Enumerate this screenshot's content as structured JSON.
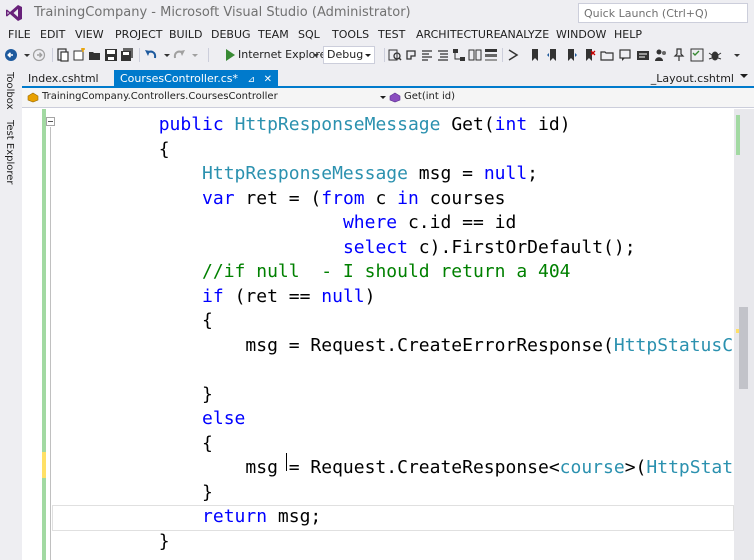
{
  "window": {
    "title": "TrainingCompany - Microsoft Visual Studio (Administrator)",
    "quick_launch_placeholder": "Quick Launch (Ctrl+Q)"
  },
  "menu": [
    "FILE",
    "EDIT",
    "VIEW",
    "PROJECT",
    "BUILD",
    "DEBUG",
    "TEAM",
    "SQL",
    "TOOLS",
    "TEST",
    "ARCHITECTURE",
    "ANALYZE",
    "WINDOW",
    "HELP"
  ],
  "toolbar": {
    "run_label": "Internet Explorer",
    "configuration": "Debug"
  },
  "side_panels": [
    "Toolbox",
    "Test Explorer"
  ],
  "tabs": {
    "inactive": "Index.cshtml",
    "active": "CoursesController.cs*",
    "right": "_Layout.cshtml"
  },
  "navigation": {
    "class_path": "TrainingCompany.Controllers.CoursesController",
    "member": "Get(int id)"
  },
  "code_lines": [
    [
      {
        "t": "        "
      },
      {
        "t": "public",
        "c": "kw"
      },
      {
        "t": " "
      },
      {
        "t": "HttpResponseMessage",
        "c": "ty"
      },
      {
        "t": " Get("
      },
      {
        "t": "int",
        "c": "kw"
      },
      {
        "t": " id)"
      }
    ],
    [
      {
        "t": "        {"
      }
    ],
    [
      {
        "t": "            "
      },
      {
        "t": "HttpResponseMessage",
        "c": "ty"
      },
      {
        "t": " msg = "
      },
      {
        "t": "null",
        "c": "kw"
      },
      {
        "t": ";"
      }
    ],
    [
      {
        "t": "            "
      },
      {
        "t": "var",
        "c": "kw"
      },
      {
        "t": " ret = ("
      },
      {
        "t": "from",
        "c": "kw"
      },
      {
        "t": " c "
      },
      {
        "t": "in",
        "c": "kw"
      },
      {
        "t": " courses"
      }
    ],
    [
      {
        "t": "                         "
      },
      {
        "t": "where",
        "c": "kw"
      },
      {
        "t": " c.id == id"
      }
    ],
    [
      {
        "t": "                         "
      },
      {
        "t": "select",
        "c": "kw"
      },
      {
        "t": " c).FirstOrDefault();"
      }
    ],
    [
      {
        "t": "            "
      },
      {
        "t": "//if null  - I should return a 404",
        "c": "cm"
      }
    ],
    [
      {
        "t": "            "
      },
      {
        "t": "if",
        "c": "kw"
      },
      {
        "t": " (ret == "
      },
      {
        "t": "null",
        "c": "kw"
      },
      {
        "t": ")"
      }
    ],
    [
      {
        "t": "            {"
      }
    ],
    [
      {
        "t": "                msg = Request.CreateErrorResponse("
      },
      {
        "t": "HttpStatusCode",
        "c": "ty"
      },
      {
        "t": "."
      }
    ],
    [
      {
        "t": ""
      }
    ],
    [
      {
        "t": "            }"
      }
    ],
    [
      {
        "t": "            "
      },
      {
        "t": "else",
        "c": "kw"
      }
    ],
    [
      {
        "t": "            {"
      }
    ],
    [
      {
        "t": "                msg = Request.CreateResponse<"
      },
      {
        "t": "course",
        "c": "ty"
      },
      {
        "t": ">("
      },
      {
        "t": "HttpStatusCo",
        "c": "ty"
      }
    ],
    [
      {
        "t": "            }"
      }
    ],
    [
      {
        "t": "            "
      },
      {
        "t": "return",
        "c": "kw"
      },
      {
        "t": " msg;"
      }
    ],
    [
      {
        "t": "        }"
      }
    ]
  ],
  "colors": {
    "keyword": "#0000ff",
    "type": "#2b91af",
    "comment": "#008000",
    "accent": "#007acc"
  }
}
